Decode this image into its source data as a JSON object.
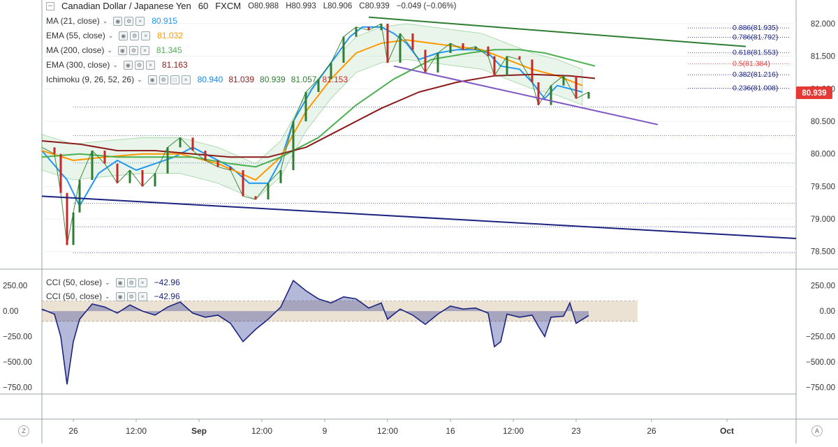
{
  "header": {
    "symbol": "Canadian Dollar / Japanese Yen",
    "interval": "60",
    "source": "FXCM",
    "open": "O80.988",
    "high": "H80.993",
    "low": "L80.906",
    "close": "C80.939",
    "change": "−0.049 (−0.06%)"
  },
  "indicators": [
    {
      "label": "MA (21, close)",
      "value": "80.915",
      "color": "#2196f3"
    },
    {
      "label": "EMA (55, close)",
      "value": "81.032",
      "color": "#ff9800"
    },
    {
      "label": "MA (200, close)",
      "value": "81.345",
      "color": "#4caf50"
    },
    {
      "label": "EMA (300, close)",
      "value": "81.163",
      "color": "#8b1a1a"
    },
    {
      "label": "Ichimoku (9, 26, 52, 26)",
      "values": [
        "80.940",
        "81.039",
        "80.939",
        "81.057",
        "81.153"
      ],
      "colors": [
        "#1e88e5",
        "#8b1a1a",
        "#2e7d32",
        "#2e7d32",
        "#c62828"
      ]
    }
  ],
  "cci_legend": [
    {
      "label": "CCI (50, close)",
      "value": "−42.96"
    },
    {
      "label": "CCI (50, close)",
      "value": "−42.96"
    }
  ],
  "chart_data": [
    {
      "type": "line",
      "title": "Canadian Dollar / Japanese Yen 60 FXCM",
      "price_axis_ticks": [
        "82.000",
        "81.500",
        "81.000",
        "80.500",
        "80.000",
        "79.500",
        "79.000",
        "78.500"
      ],
      "ylim": [
        78.4,
        82.15
      ],
      "time_axis_ticks": [
        "26",
        "12:00",
        "Sep",
        "12:00",
        "9",
        "12:00",
        "16",
        "12:00",
        "23",
        "26",
        "Oct"
      ],
      "last_price_label": "80.939",
      "last_price_color": "#e53935",
      "series": [
        {
          "name": "MA (21, close)",
          "color": "#2196f3",
          "points": [
            [
              0,
              80.05
            ],
            [
              4,
              79.6
            ],
            [
              6,
              79.2
            ],
            [
              9,
              79.7
            ],
            [
              12,
              79.9
            ],
            [
              15,
              79.75
            ],
            [
              18,
              79.85
            ],
            [
              21,
              79.95
            ],
            [
              24,
              80.1
            ],
            [
              27,
              79.95
            ],
            [
              30,
              79.8
            ],
            [
              33,
              79.55
            ],
            [
              36,
              79.55
            ],
            [
              38,
              79.9
            ],
            [
              40,
              80.5
            ],
            [
              43,
              81.0
            ],
            [
              46,
              81.4
            ],
            [
              49,
              81.8
            ],
            [
              51,
              81.95
            ],
            [
              54,
              81.95
            ],
            [
              56,
              81.85
            ],
            [
              58,
              81.7
            ],
            [
              60,
              81.45
            ],
            [
              63,
              81.55
            ],
            [
              66,
              81.6
            ],
            [
              69,
              81.6
            ],
            [
              71,
              81.55
            ],
            [
              73,
              81.35
            ],
            [
              76,
              81.3
            ],
            [
              78,
              81.1
            ],
            [
              80,
              80.85
            ],
            [
              82,
              81.05
            ],
            [
              84,
              81.0
            ],
            [
              86,
              80.95
            ]
          ]
        },
        {
          "name": "EMA (55, close)",
          "color": "#ff9800",
          "points": [
            [
              0,
              80.05
            ],
            [
              5,
              79.9
            ],
            [
              10,
              79.95
            ],
            [
              16,
              80.0
            ],
            [
              22,
              80.0
            ],
            [
              28,
              79.85
            ],
            [
              34,
              79.6
            ],
            [
              38,
              79.95
            ],
            [
              42,
              80.65
            ],
            [
              46,
              81.15
            ],
            [
              50,
              81.55
            ],
            [
              54,
              81.7
            ],
            [
              58,
              81.75
            ],
            [
              62,
              81.7
            ],
            [
              66,
              81.65
            ],
            [
              70,
              81.6
            ],
            [
              74,
              81.45
            ],
            [
              78,
              81.3
            ],
            [
              82,
              81.2
            ],
            [
              86,
              81.05
            ]
          ]
        },
        {
          "name": "MA (200, close)",
          "color": "#4caf50",
          "points": [
            [
              0,
              79.95
            ],
            [
              6,
              80.0
            ],
            [
              12,
              79.95
            ],
            [
              18,
              79.95
            ],
            [
              24,
              79.95
            ],
            [
              30,
              79.85
            ],
            [
              34,
              79.8
            ],
            [
              38,
              79.95
            ],
            [
              44,
              80.25
            ],
            [
              50,
              80.75
            ],
            [
              56,
              81.15
            ],
            [
              62,
              81.45
            ],
            [
              68,
              81.55
            ],
            [
              72,
              81.6
            ],
            [
              76,
              81.6
            ],
            [
              80,
              81.55
            ],
            [
              84,
              81.45
            ],
            [
              88,
              81.35
            ]
          ]
        },
        {
          "name": "EMA (300, close)",
          "color": "#8b1a1a",
          "points": [
            [
              0,
              80.2
            ],
            [
              6,
              80.15
            ],
            [
              12,
              80.05
            ],
            [
              18,
              80.05
            ],
            [
              24,
              80.0
            ],
            [
              30,
              79.95
            ],
            [
              36,
              79.95
            ],
            [
              42,
              80.1
            ],
            [
              48,
              80.4
            ],
            [
              54,
              80.7
            ],
            [
              60,
              80.95
            ],
            [
              66,
              81.1
            ],
            [
              72,
              81.2
            ],
            [
              78,
              81.22
            ],
            [
              84,
              81.2
            ],
            [
              88,
              81.16
            ]
          ]
        },
        {
          "name": "Price",
          "color": "#2e7d32",
          "points": [
            [
              0,
              80.1
            ],
            [
              2,
              80.0
            ],
            [
              3,
              79.4
            ],
            [
              4,
              78.6
            ],
            [
              5,
              79.1
            ],
            [
              6,
              79.6
            ],
            [
              8,
              80.05
            ],
            [
              10,
              79.85
            ],
            [
              12,
              79.55
            ],
            [
              14,
              79.75
            ],
            [
              16,
              79.5
            ],
            [
              18,
              79.7
            ],
            [
              20,
              80.1
            ],
            [
              22,
              80.25
            ],
            [
              24,
              80.05
            ],
            [
              26,
              79.9
            ],
            [
              28,
              79.8
            ],
            [
              30,
              79.75
            ],
            [
              32,
              79.35
            ],
            [
              34,
              79.3
            ],
            [
              36,
              79.55
            ],
            [
              38,
              79.75
            ],
            [
              40,
              80.5
            ],
            [
              42,
              80.95
            ],
            [
              44,
              81.15
            ],
            [
              46,
              81.4
            ],
            [
              48,
              81.8
            ],
            [
              50,
              81.95
            ],
            [
              52,
              81.9
            ],
            [
              54,
              82.0
            ],
            [
              55,
              81.4
            ],
            [
              57,
              81.85
            ],
            [
              59,
              81.6
            ],
            [
              61,
              81.25
            ],
            [
              63,
              81.55
            ],
            [
              65,
              81.7
            ],
            [
              67,
              81.6
            ],
            [
              69,
              81.65
            ],
            [
              71,
              81.5
            ],
            [
              72,
              81.2
            ],
            [
              74,
              81.5
            ],
            [
              76,
              81.45
            ],
            [
              78,
              81.1
            ],
            [
              79,
              80.75
            ],
            [
              81,
              81.05
            ],
            [
              83,
              81.2
            ],
            [
              85,
              80.85
            ],
            [
              87,
              80.95
            ]
          ]
        }
      ],
      "trendlines": [
        {
          "color": "#2e7d32",
          "from": [
            52,
            82.1
          ],
          "to": [
            112,
            81.65
          ]
        },
        {
          "color": "#7e57c2",
          "from": [
            56,
            81.35
          ],
          "to": [
            98,
            80.45
          ]
        },
        {
          "color": "#1a237e",
          "from": [
            0,
            79.35
          ],
          "to": [
            120,
            78.7
          ]
        }
      ],
      "fibonacci": [
        {
          "label": "0.886(81.935)",
          "value": 81.935
        },
        {
          "label": "0.786(81.792)",
          "value": 81.792
        },
        {
          "label": "0.618(81.553)",
          "value": 81.553
        },
        {
          "label": "0.5(81.384)",
          "value": 81.384,
          "color": "#e53935"
        },
        {
          "label": "0.382(81.216)",
          "value": 81.216
        },
        {
          "label": "0.236(81.008)",
          "value": 81.008
        }
      ],
      "dotted_levels": [
        80.72,
        80.28,
        79.86,
        79.24,
        78.88,
        78.48
      ]
    },
    {
      "type": "area",
      "title": "CCI (50, close)",
      "ylim": [
        -780,
        350
      ],
      "ticks": [
        "250.00",
        "0.00",
        "−250.00",
        "−500.00",
        "−750.00"
      ],
      "band": [
        100,
        -100
      ],
      "points": [
        [
          0,
          20
        ],
        [
          2,
          -30
        ],
        [
          3,
          -250
        ],
        [
          4,
          -720
        ],
        [
          5,
          -300
        ],
        [
          6,
          -80
        ],
        [
          8,
          70
        ],
        [
          10,
          40
        ],
        [
          12,
          -20
        ],
        [
          14,
          60
        ],
        [
          16,
          0
        ],
        [
          18,
          -40
        ],
        [
          20,
          40
        ],
        [
          22,
          90
        ],
        [
          24,
          -20
        ],
        [
          26,
          -60
        ],
        [
          28,
          -40
        ],
        [
          30,
          -120
        ],
        [
          32,
          -300
        ],
        [
          34,
          -180
        ],
        [
          36,
          -80
        ],
        [
          38,
          40
        ],
        [
          40,
          300
        ],
        [
          42,
          200
        ],
        [
          44,
          120
        ],
        [
          46,
          80
        ],
        [
          48,
          140
        ],
        [
          50,
          120
        ],
        [
          52,
          30
        ],
        [
          54,
          80
        ],
        [
          55,
          -80
        ],
        [
          57,
          20
        ],
        [
          59,
          -40
        ],
        [
          61,
          -130
        ],
        [
          63,
          -30
        ],
        [
          65,
          50
        ],
        [
          67,
          20
        ],
        [
          69,
          30
        ],
        [
          71,
          -20
        ],
        [
          72,
          -350
        ],
        [
          73,
          -300
        ],
        [
          74,
          -30
        ],
        [
          76,
          -60
        ],
        [
          78,
          -40
        ],
        [
          79,
          -150
        ],
        [
          80,
          -250
        ],
        [
          81,
          -60
        ],
        [
          83,
          -50
        ],
        [
          84,
          80
        ],
        [
          85,
          -120
        ],
        [
          87,
          -43
        ]
      ]
    }
  ]
}
